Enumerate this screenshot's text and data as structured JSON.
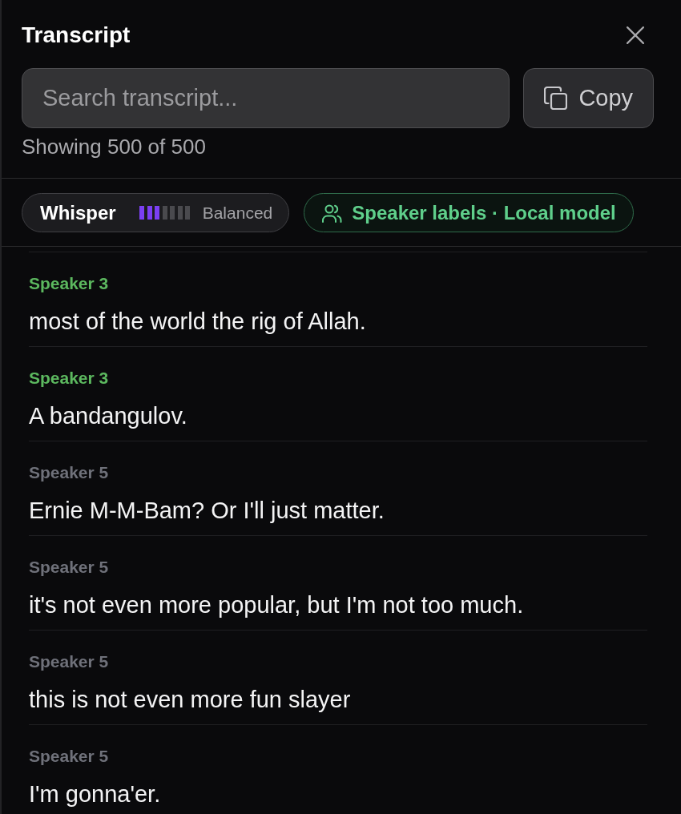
{
  "panel": {
    "title": "Transcript",
    "search": {
      "placeholder": "Search transcript..."
    },
    "copy_button": "Copy",
    "count": "Showing 500 of 500"
  },
  "model_chip": {
    "name": "Whisper",
    "level": 0.43,
    "mode": "Balanced"
  },
  "speaker_chip": {
    "label": "Speaker labels · Local model"
  },
  "entries": [
    {
      "speaker": "Speaker 3",
      "color": "#5cb85f",
      "text": "most of the world the rig of Allah."
    },
    {
      "speaker": "Speaker 3",
      "color": "#5cb85f",
      "text": "A bandangulov."
    },
    {
      "speaker": "Speaker 5",
      "color": "#6f717a",
      "text": "Ernie M-M-Bam? Or I'll just matter."
    },
    {
      "speaker": "Speaker 5",
      "color": "#6f717a",
      "text": "it's not even more popular, but I'm not too much."
    },
    {
      "speaker": "Speaker 5",
      "color": "#6f717a",
      "text": "this is not even more fun slayer"
    },
    {
      "speaker": "Speaker 5",
      "color": "#6f717a",
      "text": "I'm gonna'er."
    }
  ]
}
